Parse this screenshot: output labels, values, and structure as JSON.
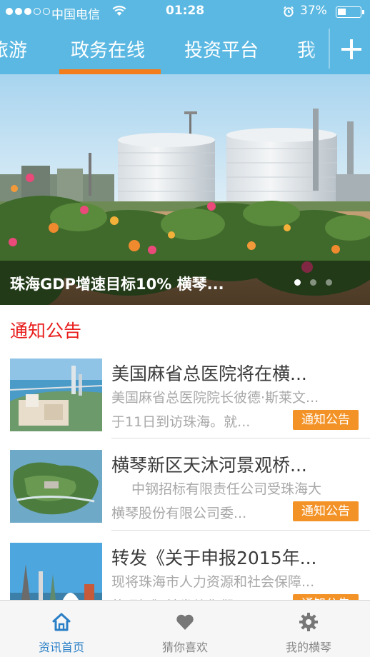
{
  "status_bar": {
    "carrier": "中国电信",
    "time": "01:28",
    "battery_percent": "37%",
    "signal_bars_filled": 3,
    "signal_bars_total": 5
  },
  "channel_tabs": {
    "items": [
      "旅游",
      "政务在线",
      "投资平台",
      "我"
    ],
    "selected_index": 1,
    "add_icon": "plus-icon"
  },
  "banner": {
    "title": "珠海GDP增速目标10% 横琴...",
    "page_count": 3,
    "current_page": 1
  },
  "section": {
    "title": "通知公告"
  },
  "news": [
    {
      "title": "美国麻省总医院将在横...",
      "desc_line1": "美国麻省总医院院长彼德·斯莱文...",
      "desc_line2": "于11日到访珠海。就...",
      "tag": "通知公告"
    },
    {
      "title": "横琴新区天沐河景观桥...",
      "desc_line1": "中钢招标有限责任公司受珠海大",
      "desc_line2": "横琴股份有限公司委...",
      "tag": "通知公告"
    },
    {
      "title": "转发《关于申报2015年...",
      "desc_line1": "现将珠海市人力资源和社会保障...",
      "desc_line2": "的通知》转发给你们",
      "tag": "通知公告"
    }
  ],
  "tab_bar": {
    "items": [
      {
        "label": "资讯首页",
        "icon": "home-icon"
      },
      {
        "label": "猜你喜欢",
        "icon": "heart-icon"
      },
      {
        "label": "我的横琴",
        "icon": "gear-icon"
      }
    ],
    "selected_index": 0,
    "active_color": "#2a7fc6",
    "inactive_color": "#888888"
  },
  "colors": {
    "header_bg": "#5bb8e2",
    "tab_indicator": "#f27d1a",
    "section_title": "#e8201e",
    "tag_bg": "#f39327"
  }
}
